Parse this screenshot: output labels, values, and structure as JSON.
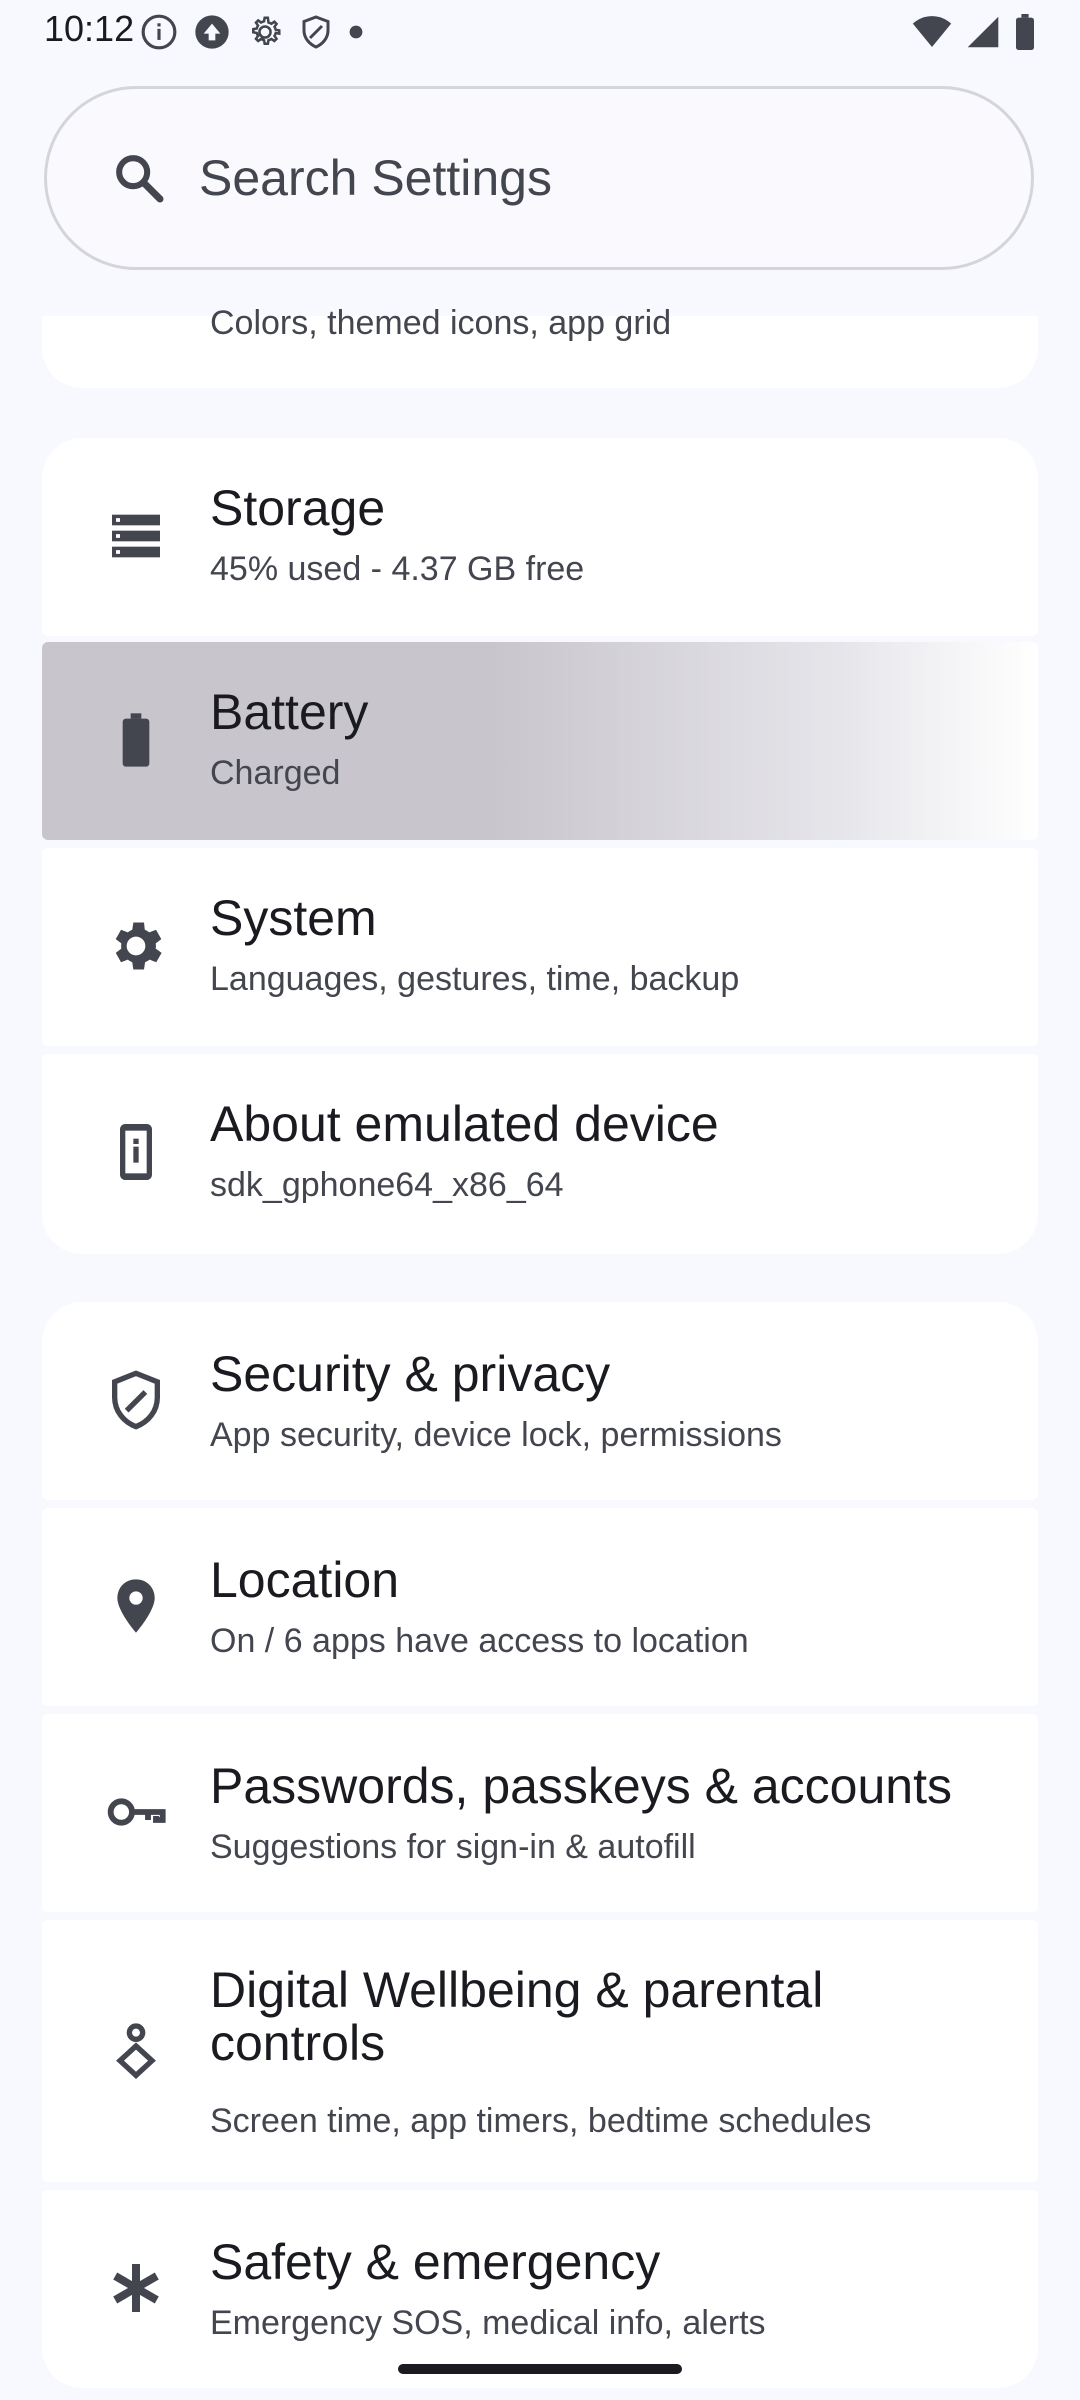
{
  "status_bar": {
    "time": "10:12"
  },
  "search": {
    "placeholder": "Search Settings"
  },
  "items": [
    {
      "title": "",
      "subtitle": "Colors, themed icons, app grid",
      "icon": "wallpaper-icon"
    },
    {
      "title": "Storage",
      "subtitle": "45% used - 4.37 GB free",
      "icon": "storage-icon"
    },
    {
      "title": "Battery",
      "subtitle": "Charged",
      "icon": "battery-icon"
    },
    {
      "title": "System",
      "subtitle": "Languages, gestures, time, backup",
      "icon": "gear-icon"
    },
    {
      "title": "About emulated device",
      "subtitle": "sdk_gphone64_x86_64",
      "icon": "phone-info-icon"
    },
    {
      "title": "Security & privacy",
      "subtitle": "App security, device lock, permissions",
      "icon": "shield-icon"
    },
    {
      "title": "Location",
      "subtitle": "On / 6 apps have access to location",
      "icon": "location-pin-icon"
    },
    {
      "title": "Passwords, passkeys & accounts",
      "subtitle": "Suggestions for sign-in & autofill",
      "icon": "key-icon"
    },
    {
      "title": "Digital Wellbeing & parental controls",
      "subtitle": "Screen time, app timers, bedtime schedules",
      "icon": "wellbeing-icon"
    },
    {
      "title": "Safety & emergency",
      "subtitle": "Emergency SOS, medical info, alerts",
      "icon": "asterisk-icon"
    }
  ],
  "colors": {
    "background": "#f8f9ff",
    "card": "#ffffff",
    "pressed_highlight": "#c8c6cc",
    "text_primary": "#1a1b20",
    "text_secondary": "#44464f"
  }
}
